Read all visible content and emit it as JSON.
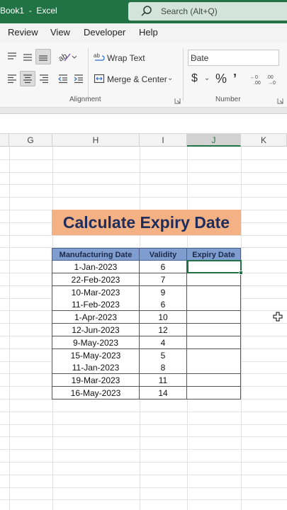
{
  "titlebar": {
    "title": "Book1  -  Excel"
  },
  "search": {
    "placeholder": "Search (Alt+Q)"
  },
  "menu": {
    "items": [
      "Review",
      "View",
      "Developer",
      "Help"
    ]
  },
  "ribbon": {
    "wrap_text": "Wrap Text",
    "merge_center": "Merge & Center",
    "alignment_label": "Alignment",
    "number_format": "Date",
    "number_label": "Number",
    "currency_symbol": "$",
    "percent_symbol": "%",
    "comma_symbol": "9"
  },
  "columns": [
    "G",
    "H",
    "I",
    "J",
    "K"
  ],
  "banner": {
    "title": "Calculate Expiry Date"
  },
  "table": {
    "headers": [
      "Manufacturing  Date",
      "Validity",
      "Expiry Date"
    ],
    "rows": [
      [
        "1-Jan-2023",
        "6",
        ""
      ],
      [
        "22-Feb-2023",
        "7",
        ""
      ],
      [
        "10-Mar-2023",
        "9",
        ""
      ],
      [
        "11-Feb-2023",
        "6",
        ""
      ],
      [
        "1-Apr-2023",
        "10",
        ""
      ],
      [
        "12-Jun-2023",
        "12",
        ""
      ],
      [
        "9-May-2023",
        "4",
        ""
      ],
      [
        "15-May-2023",
        "5",
        ""
      ],
      [
        "11-Jan-2023",
        "8",
        ""
      ],
      [
        "19-Mar-2023",
        "11",
        ""
      ],
      [
        "16-May-2023",
        "14",
        ""
      ]
    ]
  },
  "colors": {
    "excel_green": "#217346",
    "banner_fill": "#f4b183",
    "header_fill": "#7f9dcf"
  }
}
